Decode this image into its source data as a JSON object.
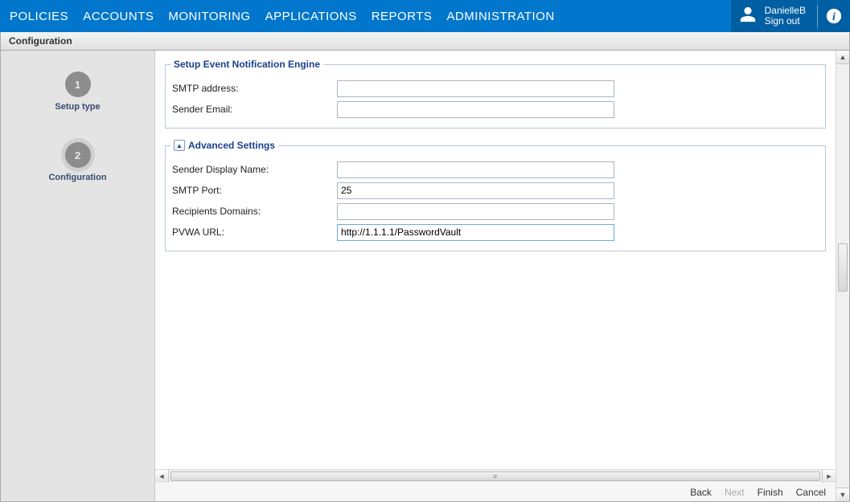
{
  "header": {
    "nav": [
      "POLICIES",
      "ACCOUNTS",
      "MONITORING",
      "APPLICATIONS",
      "REPORTS",
      "ADMINISTRATION"
    ],
    "user": {
      "name": "DanielleB",
      "signout": "Sign out"
    }
  },
  "tab": {
    "title": "Configuration"
  },
  "sidebar": {
    "steps": [
      {
        "num": "1",
        "label": "Setup type",
        "active": false
      },
      {
        "num": "2",
        "label": "Configuration",
        "active": true
      }
    ]
  },
  "sections": {
    "ene": {
      "legend": "Setup Event Notification Engine",
      "fields": {
        "smtp_address": {
          "label": "SMTP address:",
          "value": ""
        },
        "sender_email": {
          "label": "Sender Email:",
          "value": ""
        }
      }
    },
    "adv": {
      "legend": "Advanced Settings",
      "fields": {
        "sender_display": {
          "label": "Sender Display Name:",
          "value": ""
        },
        "smtp_port": {
          "label": "SMTP Port:",
          "value": "25"
        },
        "recipients_domains": {
          "label": "Recipients Domains:",
          "value": ""
        },
        "pvwa_url": {
          "label": "PVWA URL:",
          "value": "http://1.1.1.1/PasswordVault"
        }
      }
    }
  },
  "footer": {
    "back": "Back",
    "next": "Next",
    "finish": "Finish",
    "cancel": "Cancel"
  }
}
